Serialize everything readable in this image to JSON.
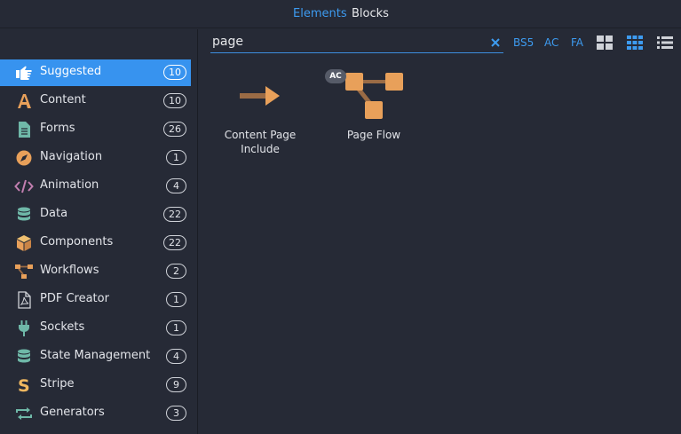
{
  "topbar": {
    "tabs": [
      "Elements",
      "Blocks"
    ]
  },
  "sidebar": {
    "items": [
      {
        "label": "Suggested",
        "count": "10",
        "icon": "pointing-hand-icon",
        "active": true
      },
      {
        "label": "Content",
        "count": "10",
        "icon": "letter-a-icon"
      },
      {
        "label": "Forms",
        "count": "26",
        "icon": "document-icon"
      },
      {
        "label": "Navigation",
        "count": "1",
        "icon": "compass-icon"
      },
      {
        "label": "Animation",
        "count": "4",
        "icon": "code-icon"
      },
      {
        "label": "Data",
        "count": "22",
        "icon": "database-icon"
      },
      {
        "label": "Components",
        "count": "22",
        "icon": "cube-icon"
      },
      {
        "label": "Workflows",
        "count": "2",
        "icon": "workflow-icon"
      },
      {
        "label": "PDF Creator",
        "count": "1",
        "icon": "pdf-icon"
      },
      {
        "label": "Sockets",
        "count": "1",
        "icon": "plug-icon"
      },
      {
        "label": "State Management",
        "count": "4",
        "icon": "database-icon"
      },
      {
        "label": "Stripe",
        "count": "9",
        "icon": "stripe-s-icon"
      },
      {
        "label": "Generators",
        "count": "3",
        "icon": "repeat-icon"
      }
    ]
  },
  "search": {
    "value": "page"
  },
  "filters": [
    "BS5",
    "AC",
    "FA"
  ],
  "results": [
    {
      "label": "Content Page Include",
      "icon": "arrow-right-icon"
    },
    {
      "label": "Page Flow",
      "icon": "page-flow-icon",
      "badge": "AC"
    }
  ],
  "colors": {
    "accent": "#3793ef",
    "background": "#262a36",
    "icon_orange": "#e8a05a",
    "icon_brown": "#9a6b45",
    "icon_teal": "#6fb8a8"
  }
}
